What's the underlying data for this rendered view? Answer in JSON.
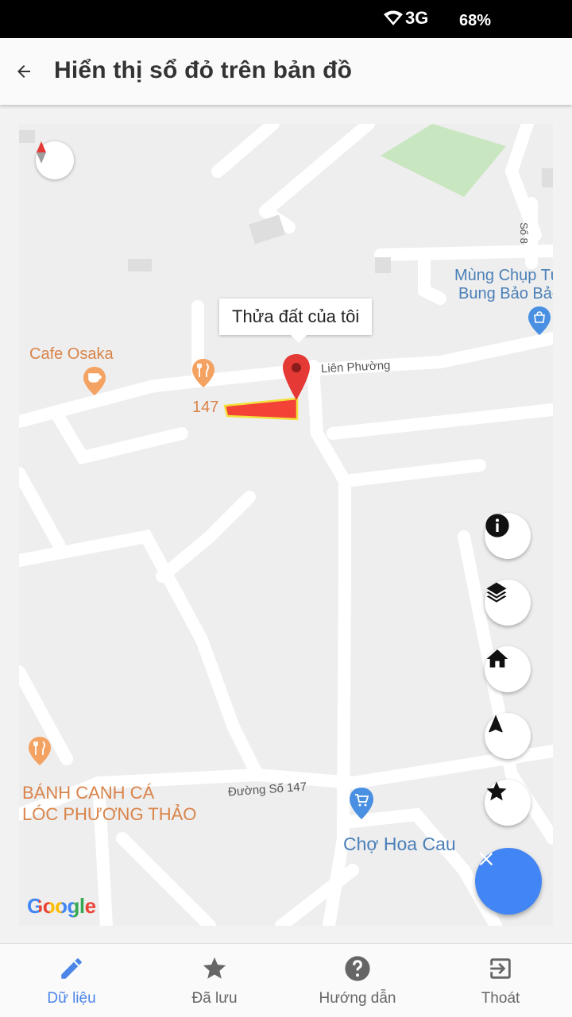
{
  "status": {
    "network": "3G",
    "battery": "68%"
  },
  "header": {
    "title": "Hiển thị sổ đỏ trên bản đồ"
  },
  "map": {
    "tooltip": "Thửa đất của tôi",
    "pois": {
      "cafe_osaka": "Cafe Osaka",
      "number_147": "147",
      "mung_line1": "Mùng Chụp Tự",
      "mung_line2": "Bung Bảo Bảo",
      "banh_canh_line1": "BÁNH CANH CÁ",
      "banh_canh_line2": "LÓC PHƯƠNG THẢO",
      "cho_hoa_cau": "Chợ Hoa Cau"
    },
    "roads": {
      "lien_phuong": "Liên Phường",
      "duong_so_147": "Đường Số 147",
      "so_8": "Số 8"
    },
    "attribution": "Google",
    "parcel_color": "#f44336",
    "accent_color": "#4285f4"
  },
  "controls": [
    "info-icon",
    "layers-icon",
    "home-icon",
    "navigation-icon",
    "star-icon",
    "close-icon"
  ],
  "bottom_nav": [
    {
      "label": "Dữ liệu",
      "icon": "pencil-icon",
      "active": true
    },
    {
      "label": "Đã lưu",
      "icon": "star-icon",
      "active": false
    },
    {
      "label": "Hướng dẫn",
      "icon": "help-icon",
      "active": false
    },
    {
      "label": "Thoát",
      "icon": "exit-icon",
      "active": false
    }
  ]
}
